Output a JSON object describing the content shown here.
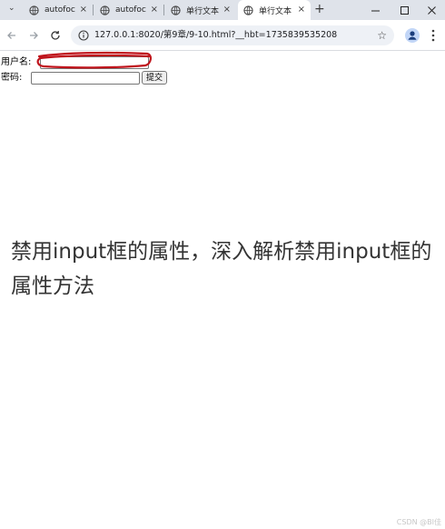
{
  "tabs": [
    {
      "title": "autofoc",
      "active": false
    },
    {
      "title": "autofoc",
      "active": false
    },
    {
      "title": "单行文本",
      "active": false
    },
    {
      "title": "单行文本",
      "active": true
    }
  ],
  "tab_close_glyph": "×",
  "new_tab_glyph": "+",
  "toolbar": {
    "url": "127.0.0.1:8020/第9章/9-10.html?__hbt=1735839535208"
  },
  "form": {
    "username_label": "用户名:",
    "username_value": "",
    "password_label": "密码:",
    "password_value": "",
    "submit_label": "提交"
  },
  "caption": "禁用input框的属性，深入解析禁用input框的属性方法",
  "watermark": "CSDN @BI佳",
  "colors": {
    "tabbar": "#dfe3ea",
    "omnibox": "#eef1f6",
    "annotation": "#c0141c"
  },
  "icons": {
    "tab_favicon": "globe-icon",
    "back": "back-arrow-icon",
    "forward": "forward-arrow-icon",
    "reload": "reload-icon",
    "site_info": "site-info-icon",
    "bookmark": "star-icon",
    "profile": "profile-icon",
    "menu": "kebab-menu-icon"
  }
}
